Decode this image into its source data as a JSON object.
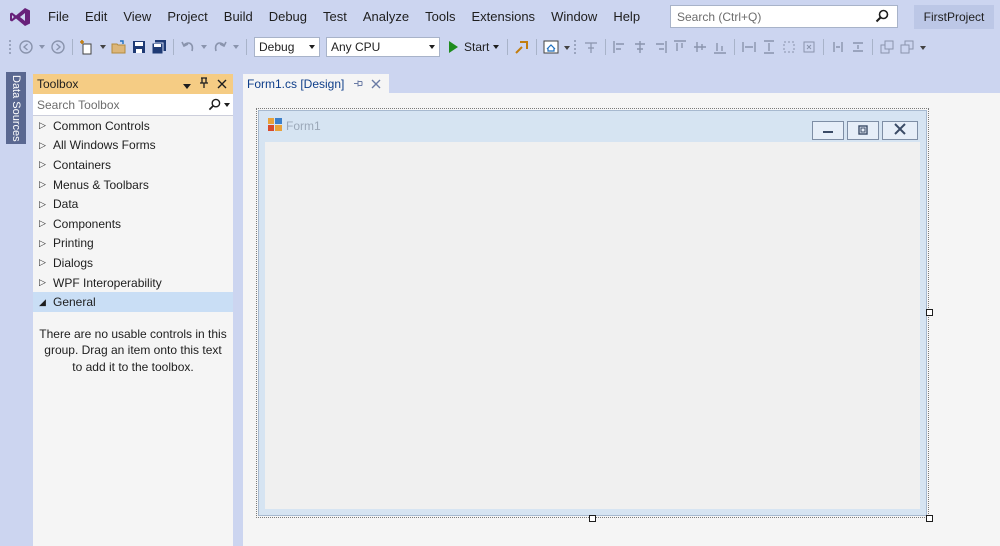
{
  "menu": {
    "items": [
      {
        "label": "File"
      },
      {
        "label": "Edit"
      },
      {
        "label": "View"
      },
      {
        "label": "Project"
      },
      {
        "label": "Build"
      },
      {
        "label": "Debug"
      },
      {
        "label": "Test"
      },
      {
        "label": "Analyze"
      },
      {
        "label": "Tools"
      },
      {
        "label": "Extensions"
      },
      {
        "label": "Window"
      },
      {
        "label": "Help"
      }
    ],
    "search_placeholder": "Search (Ctrl+Q)",
    "project_name": "FirstProject"
  },
  "toolbar": {
    "config": "Debug",
    "platform": "Any CPU",
    "start_label": "Start"
  },
  "left_strip": {
    "data_sources_label": "Data Sources"
  },
  "toolbox": {
    "title": "Toolbox",
    "search_placeholder": "Search Toolbox",
    "groups": [
      {
        "label": "Common Controls",
        "expanded": false
      },
      {
        "label": "All Windows Forms",
        "expanded": false
      },
      {
        "label": "Containers",
        "expanded": false
      },
      {
        "label": "Menus & Toolbars",
        "expanded": false
      },
      {
        "label": "Data",
        "expanded": false
      },
      {
        "label": "Components",
        "expanded": false
      },
      {
        "label": "Printing",
        "expanded": false
      },
      {
        "label": "Dialogs",
        "expanded": false
      },
      {
        "label": "WPF Interoperability",
        "expanded": false
      },
      {
        "label": "General",
        "expanded": true
      }
    ],
    "empty_message": "There are no usable controls in this group. Drag an item onto this text to add it to the toolbox."
  },
  "document": {
    "tab_label": "Form1.cs [Design]"
  },
  "form": {
    "title": "Form1"
  },
  "colors": {
    "chrome": "#CCD5F0",
    "toolbox_header": "#F5CC84",
    "selected_row": "#C9DEF5",
    "accent": "#68217A"
  }
}
